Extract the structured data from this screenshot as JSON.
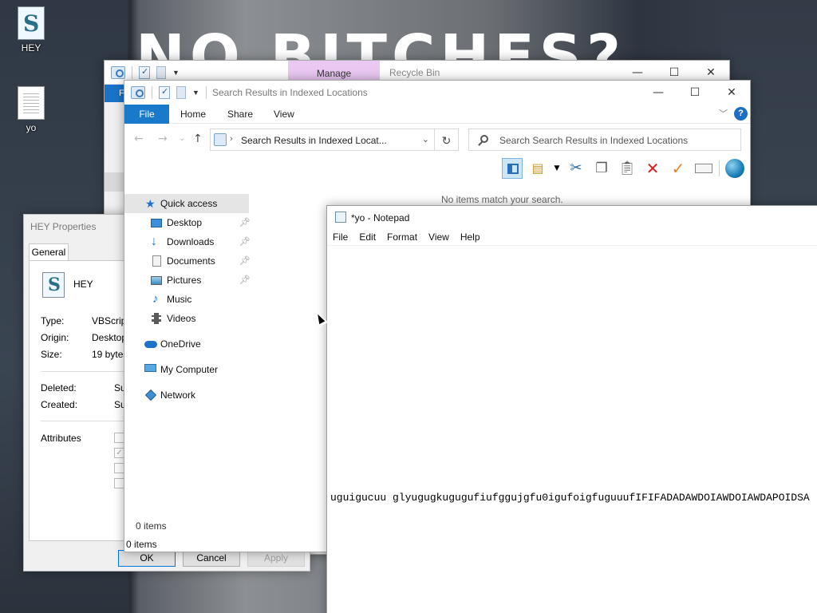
{
  "desktop": {
    "wallpaper_text": "NO BITCHES?",
    "icons": [
      {
        "label": "HEY",
        "icon": "vbscript-file-icon"
      },
      {
        "label": "yo",
        "icon": "text-file-icon"
      }
    ]
  },
  "recycle_bin": {
    "manage_tab": "Manage",
    "title": "Recycle Bin",
    "file_tab_fragment": "F",
    "status": "0 items"
  },
  "explorer": {
    "title": "Search Results in Indexed Locations",
    "ribbon_tabs": [
      "File",
      "Home",
      "Share",
      "View"
    ],
    "address_text": "Search Results in Indexed Locat...",
    "search_placeholder": "Search Search Results in Indexed Locations",
    "empty_message": "No items match your search.",
    "nav": {
      "quick_access": "Quick access",
      "pinned": [
        "Desktop",
        "Downloads",
        "Documents",
        "Pictures"
      ],
      "unpinned": [
        "Music",
        "Videos"
      ],
      "onedrive": "OneDrive",
      "my_computer": "My Computer",
      "network": "Network"
    },
    "status": "0 items",
    "toolbar_icons": [
      "preview-pane-icon",
      "properties-icon",
      "cut-icon",
      "copy-icon",
      "paste-icon",
      "delete-icon",
      "checkmark-icon",
      "rename-icon",
      "globe-icon"
    ]
  },
  "notepad": {
    "title": "*yo - Notepad",
    "menu": [
      "File",
      "Edit",
      "Format",
      "View",
      "Help"
    ],
    "content": "uguigucuu glyugugkugugufiufggujgfu0igufoigfuguuufIFIFADADAWDOIAWDOIAWDAPOIDSA"
  },
  "properties": {
    "title": "HEY Properties",
    "tab": "General",
    "file_name": "HEY",
    "rows": [
      {
        "label": "Type:",
        "value": "VBScript"
      },
      {
        "label": "Origin:",
        "value": "Desktop"
      },
      {
        "label": "Size:",
        "value": "19 bytes"
      }
    ],
    "rows2": [
      {
        "label": "Deleted:",
        "value": "Su"
      },
      {
        "label": "Created:",
        "value": "Su"
      }
    ],
    "attributes_label": "Attributes",
    "buttons": {
      "ok": "OK",
      "cancel": "Cancel",
      "apply": "Apply"
    }
  }
}
